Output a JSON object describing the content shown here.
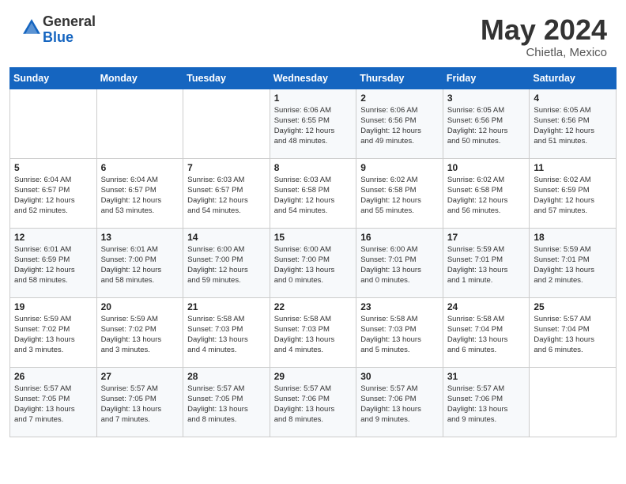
{
  "header": {
    "logo_line1": "General",
    "logo_line2": "Blue",
    "month_year": "May 2024",
    "location": "Chietla, Mexico"
  },
  "days_of_week": [
    "Sunday",
    "Monday",
    "Tuesday",
    "Wednesday",
    "Thursday",
    "Friday",
    "Saturday"
  ],
  "weeks": [
    [
      {
        "day": "",
        "info": ""
      },
      {
        "day": "",
        "info": ""
      },
      {
        "day": "",
        "info": ""
      },
      {
        "day": "1",
        "info": "Sunrise: 6:06 AM\nSunset: 6:55 PM\nDaylight: 12 hours\nand 48 minutes."
      },
      {
        "day": "2",
        "info": "Sunrise: 6:06 AM\nSunset: 6:56 PM\nDaylight: 12 hours\nand 49 minutes."
      },
      {
        "day": "3",
        "info": "Sunrise: 6:05 AM\nSunset: 6:56 PM\nDaylight: 12 hours\nand 50 minutes."
      },
      {
        "day": "4",
        "info": "Sunrise: 6:05 AM\nSunset: 6:56 PM\nDaylight: 12 hours\nand 51 minutes."
      }
    ],
    [
      {
        "day": "5",
        "info": "Sunrise: 6:04 AM\nSunset: 6:57 PM\nDaylight: 12 hours\nand 52 minutes."
      },
      {
        "day": "6",
        "info": "Sunrise: 6:04 AM\nSunset: 6:57 PM\nDaylight: 12 hours\nand 53 minutes."
      },
      {
        "day": "7",
        "info": "Sunrise: 6:03 AM\nSunset: 6:57 PM\nDaylight: 12 hours\nand 54 minutes."
      },
      {
        "day": "8",
        "info": "Sunrise: 6:03 AM\nSunset: 6:58 PM\nDaylight: 12 hours\nand 54 minutes."
      },
      {
        "day": "9",
        "info": "Sunrise: 6:02 AM\nSunset: 6:58 PM\nDaylight: 12 hours\nand 55 minutes."
      },
      {
        "day": "10",
        "info": "Sunrise: 6:02 AM\nSunset: 6:58 PM\nDaylight: 12 hours\nand 56 minutes."
      },
      {
        "day": "11",
        "info": "Sunrise: 6:02 AM\nSunset: 6:59 PM\nDaylight: 12 hours\nand 57 minutes."
      }
    ],
    [
      {
        "day": "12",
        "info": "Sunrise: 6:01 AM\nSunset: 6:59 PM\nDaylight: 12 hours\nand 58 minutes."
      },
      {
        "day": "13",
        "info": "Sunrise: 6:01 AM\nSunset: 7:00 PM\nDaylight: 12 hours\nand 58 minutes."
      },
      {
        "day": "14",
        "info": "Sunrise: 6:00 AM\nSunset: 7:00 PM\nDaylight: 12 hours\nand 59 minutes."
      },
      {
        "day": "15",
        "info": "Sunrise: 6:00 AM\nSunset: 7:00 PM\nDaylight: 13 hours\nand 0 minutes."
      },
      {
        "day": "16",
        "info": "Sunrise: 6:00 AM\nSunset: 7:01 PM\nDaylight: 13 hours\nand 0 minutes."
      },
      {
        "day": "17",
        "info": "Sunrise: 5:59 AM\nSunset: 7:01 PM\nDaylight: 13 hours\nand 1 minute."
      },
      {
        "day": "18",
        "info": "Sunrise: 5:59 AM\nSunset: 7:01 PM\nDaylight: 13 hours\nand 2 minutes."
      }
    ],
    [
      {
        "day": "19",
        "info": "Sunrise: 5:59 AM\nSunset: 7:02 PM\nDaylight: 13 hours\nand 3 minutes."
      },
      {
        "day": "20",
        "info": "Sunrise: 5:59 AM\nSunset: 7:02 PM\nDaylight: 13 hours\nand 3 minutes."
      },
      {
        "day": "21",
        "info": "Sunrise: 5:58 AM\nSunset: 7:03 PM\nDaylight: 13 hours\nand 4 minutes."
      },
      {
        "day": "22",
        "info": "Sunrise: 5:58 AM\nSunset: 7:03 PM\nDaylight: 13 hours\nand 4 minutes."
      },
      {
        "day": "23",
        "info": "Sunrise: 5:58 AM\nSunset: 7:03 PM\nDaylight: 13 hours\nand 5 minutes."
      },
      {
        "day": "24",
        "info": "Sunrise: 5:58 AM\nSunset: 7:04 PM\nDaylight: 13 hours\nand 6 minutes."
      },
      {
        "day": "25",
        "info": "Sunrise: 5:57 AM\nSunset: 7:04 PM\nDaylight: 13 hours\nand 6 minutes."
      }
    ],
    [
      {
        "day": "26",
        "info": "Sunrise: 5:57 AM\nSunset: 7:05 PM\nDaylight: 13 hours\nand 7 minutes."
      },
      {
        "day": "27",
        "info": "Sunrise: 5:57 AM\nSunset: 7:05 PM\nDaylight: 13 hours\nand 7 minutes."
      },
      {
        "day": "28",
        "info": "Sunrise: 5:57 AM\nSunset: 7:05 PM\nDaylight: 13 hours\nand 8 minutes."
      },
      {
        "day": "29",
        "info": "Sunrise: 5:57 AM\nSunset: 7:06 PM\nDaylight: 13 hours\nand 8 minutes."
      },
      {
        "day": "30",
        "info": "Sunrise: 5:57 AM\nSunset: 7:06 PM\nDaylight: 13 hours\nand 9 minutes."
      },
      {
        "day": "31",
        "info": "Sunrise: 5:57 AM\nSunset: 7:06 PM\nDaylight: 13 hours\nand 9 minutes."
      },
      {
        "day": "",
        "info": ""
      }
    ]
  ]
}
